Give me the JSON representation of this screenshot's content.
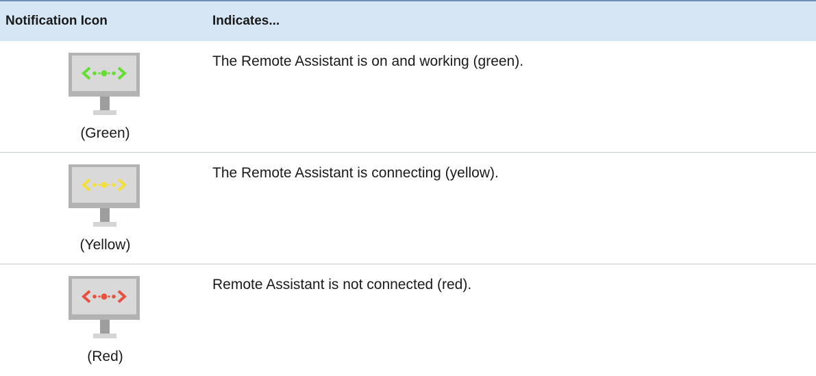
{
  "table": {
    "headers": {
      "icon": "Notification Icon",
      "indicates": "Indicates..."
    },
    "rows": [
      {
        "caption": "(Green)",
        "description": "The Remote Assistant is on and working (green).",
        "color": "#66dd33",
        "icon": "monitor-green-icon"
      },
      {
        "caption": "(Yellow)",
        "description": "The Remote Assistant is connecting (yellow).",
        "color": "#f2e03a",
        "icon": "monitor-yellow-icon"
      },
      {
        "caption": "(Red)",
        "description": "Remote Assistant is not connected (red).",
        "color": "#e8503f",
        "icon": "monitor-red-icon"
      }
    ]
  }
}
